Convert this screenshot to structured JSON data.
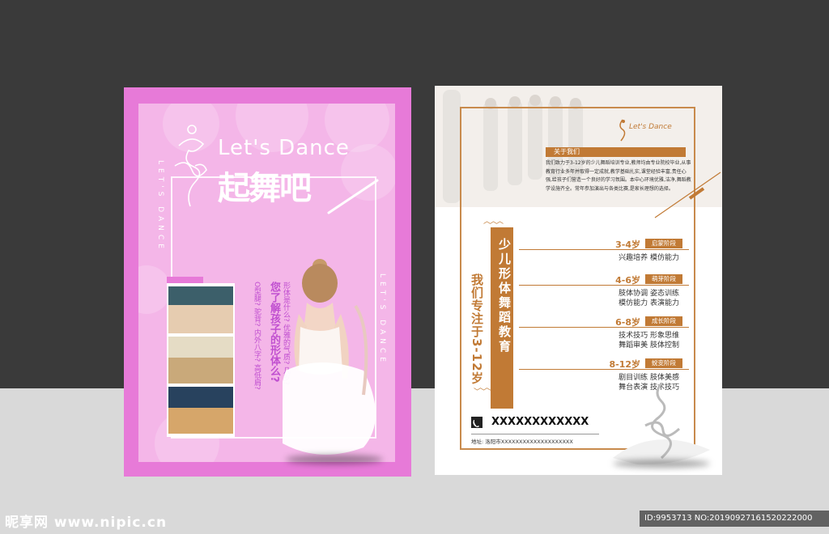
{
  "left_flyer": {
    "title_en": "Let's Dance",
    "title_cn": "起舞吧",
    "vertical_en_left": "LET'S DANCE",
    "vertical_en_right": "LET'S DANCE",
    "question_main": "您了解孩子的形体么?",
    "question_sub1": "形体是什么? 优雅的气质? 几岁?",
    "question_sub2": "O型腿? 驼背? 内外八字? 高低肩?"
  },
  "right_flyer": {
    "brand": "Let's Dance",
    "about_label": "关于我们",
    "about_text": "我们致力于3-12岁的少儿舞蹈培训专业,教师均由专业院校毕业,从事教育行业多年并取得一定成就,教学基础扎实,课堂经验丰富,责任心强,给孩子们营造一个良好的学习氛围。本中心环境优雅,洁净,舞蹈教学设施齐全。常年参加演出与各类比赛,是家长理想的选择。",
    "bar_title": "少儿形体舞蹈教育",
    "left_text": "我们专注于3-12岁",
    "stages": [
      {
        "age": "3-4岁",
        "tag": "启蒙阶段",
        "skills": [
          "兴趣培养  模仿能力"
        ]
      },
      {
        "age": "4-6岁",
        "tag": "萌芽阶段",
        "skills": [
          "肢体协调 姿态训练",
          "模仿能力 表演能力"
        ]
      },
      {
        "age": "6-8岁",
        "tag": "成长阶段",
        "skills": [
          "技术技巧 形象思维",
          "舞蹈审美 肢体控制"
        ]
      },
      {
        "age": "8-12岁",
        "tag": "蜕变阶段",
        "skills": [
          "剧目训练 肢体美感",
          "舞台表演 技术技巧"
        ]
      }
    ],
    "phone": "XXXXXXXXXXXX",
    "address": "地址: 洛阳市XXXXXXXXXXXXXXXXXXXX"
  },
  "watermark": {
    "site": "昵享网 www.nipic.cn",
    "id": "ID:9953713 NO:20190927161520222000"
  },
  "colors": {
    "pink_border": "#e77ad8",
    "pink_panel": "#f4b6e8",
    "accent_orange": "#c17a35",
    "dark_bg": "#3a3a3a",
    "light_bg": "#d9d9d9"
  }
}
